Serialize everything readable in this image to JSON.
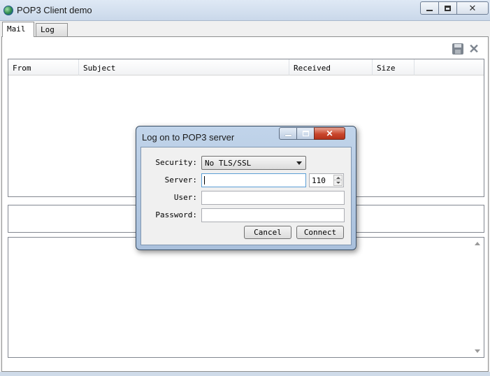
{
  "window": {
    "title": "POP3 Client demo"
  },
  "tabs": [
    {
      "label": "Mail",
      "active": true
    },
    {
      "label": "Log",
      "active": false
    }
  ],
  "toolbar": {
    "icons": [
      "save-icon",
      "delete-icon"
    ]
  },
  "mail_list": {
    "columns": [
      "From",
      "Subject",
      "Received",
      "Size"
    ],
    "rows": []
  },
  "dialog": {
    "title": "Log on to POP3 server",
    "close_glyph": "✕",
    "security_label": "Security:",
    "security_value": "No TLS/SSL",
    "server_label": "Server:",
    "server_value": "",
    "port_value": "110",
    "user_label": "User:",
    "user_value": "",
    "password_label": "Password:",
    "password_value": "",
    "cancel_label": "Cancel",
    "connect_label": "Connect"
  },
  "colors": {
    "titlebar": "#cad8ea",
    "dialog_frame": "#a9c0dc",
    "close_button": "#c9462c"
  }
}
